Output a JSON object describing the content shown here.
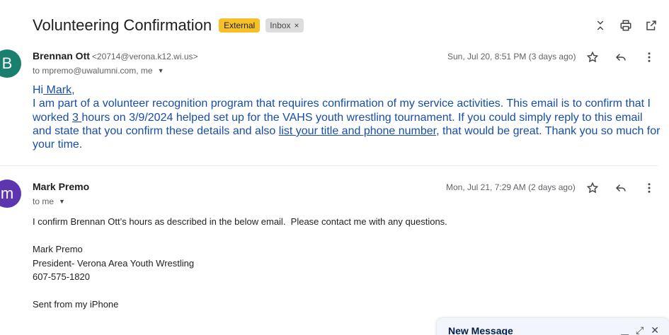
{
  "thread": {
    "subject": "Volunteering Confirmation",
    "labels": {
      "external": "External",
      "inbox": "Inbox",
      "remove": "×"
    }
  },
  "message1": {
    "avatar_letter": "B",
    "sender_name": "Brennan Ott",
    "sender_email": "<20714@verona.k12.wi.us>",
    "recipients": "to mpremo@uwalumni.com, me",
    "date": "Sun, Jul 20, 8:51 PM (3 days ago)",
    "greeting_hi": "Hi",
    "greeting_name": " Mark",
    "greeting_comma": ",",
    "body_a": "I am part of a volunteer recognition program that requires confirmation of my service activities. This email is to confirm that I worked ",
    "hours": "3 ",
    "body_b": "hours on 3/9/2024 helped set up for the VAHS youth wrestling tournament. If you could simply reply to this email and state that you confirm these details and also ",
    "link_text": "list your title and phone number",
    "body_c": ", that would be great. Thank you so much for your time."
  },
  "message2": {
    "avatar_letter": "m",
    "sender_name": "Mark Premo",
    "recipients": "to me",
    "date": "Mon, Jul 21, 7:29 AM (2 days ago)",
    "lines": [
      "I confirm Brennan Ott’s hours as described in the below email.  Please contact me with any questions.",
      "",
      "Mark Premo",
      "President- Verona Area Youth Wrestling",
      "607-575-1820",
      "",
      "Sent from my iPhone"
    ]
  },
  "compose": {
    "title": "New Message"
  },
  "colors": {
    "external_badge": "#f6c026",
    "avatar1": "#1a7f6e",
    "avatar2": "#5e35b1",
    "body_text": "#174ea6"
  }
}
